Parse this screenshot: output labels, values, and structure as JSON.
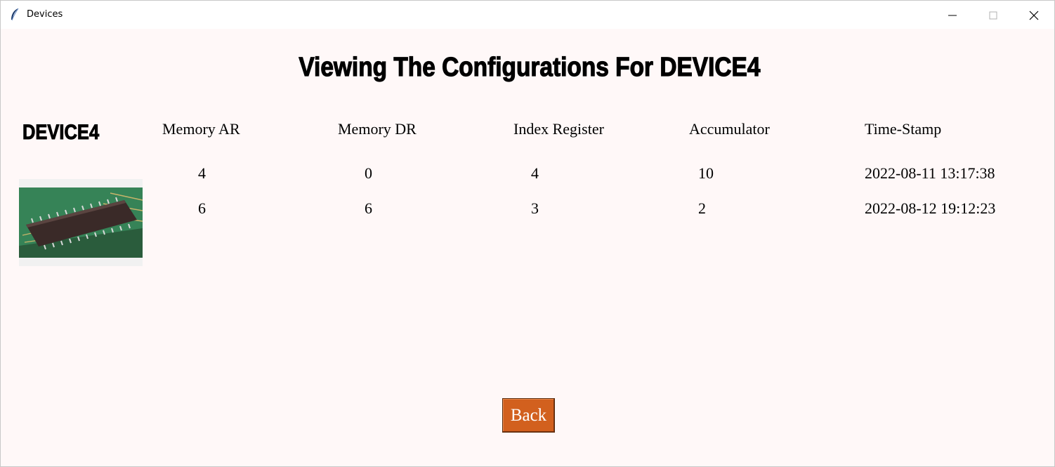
{
  "window": {
    "title": "Devices",
    "controls": {
      "minimize_icon": "minimize-icon",
      "maximize_icon": "maximize-icon",
      "close_icon": "close-icon"
    }
  },
  "page": {
    "heading": "Viewing The Configurations For DEVICE4",
    "device_name": "DEVICE4",
    "device_image": "memory-chip-photo"
  },
  "table": {
    "headers": [
      "Memory AR",
      "Memory DR",
      "Index Register",
      "Accumulator",
      "Time-Stamp"
    ],
    "rows": [
      [
        "4",
        "0",
        "4",
        "10",
        "2022-08-11 13:17:38"
      ],
      [
        "6",
        "6",
        "3",
        "2",
        "2022-08-12 19:12:23"
      ]
    ]
  },
  "actions": {
    "back_label": "Back"
  },
  "colors": {
    "background": "#fff8f8",
    "back_button": "#d2601e",
    "back_button_text": "#ffffff"
  }
}
